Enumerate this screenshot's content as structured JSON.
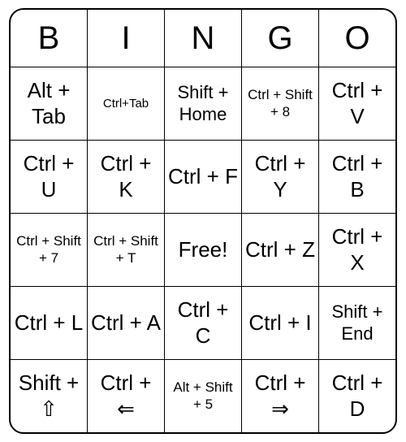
{
  "headers": [
    "B",
    "I",
    "N",
    "G",
    "O"
  ],
  "grid": [
    [
      {
        "text": "Alt + Tab",
        "size": "large"
      },
      {
        "text": "Ctrl+Tab",
        "size": "xsmall"
      },
      {
        "text": "Shift + Home",
        "size": "med"
      },
      {
        "text": "Ctrl + Shift + 8",
        "size": "small"
      },
      {
        "text": "Ctrl + V",
        "size": "large"
      }
    ],
    [
      {
        "text": "Ctrl + U",
        "size": "large"
      },
      {
        "text": "Ctrl + K",
        "size": "large"
      },
      {
        "text": "Ctrl + F",
        "size": "large"
      },
      {
        "text": "Ctrl + Y",
        "size": "large"
      },
      {
        "text": "Ctrl + B",
        "size": "large"
      }
    ],
    [
      {
        "text": "Ctrl + Shift + 7",
        "size": "small"
      },
      {
        "text": "Ctrl + Shift + T",
        "size": "small"
      },
      {
        "text": "Free!",
        "size": "large"
      },
      {
        "text": "Ctrl + Z",
        "size": "large"
      },
      {
        "text": "Ctrl + X",
        "size": "large"
      }
    ],
    [
      {
        "text": "Ctrl + L",
        "size": "large"
      },
      {
        "text": "Ctrl + A",
        "size": "large"
      },
      {
        "text": "Ctrl + C",
        "size": "large"
      },
      {
        "text": "Ctrl + I",
        "size": "large"
      },
      {
        "text": "Shift + End",
        "size": "med"
      }
    ],
    [
      {
        "text": "Shift + ⇧",
        "size": "large"
      },
      {
        "text": "Ctrl + ⇐",
        "size": "large"
      },
      {
        "text": "Alt + Shift + 5",
        "size": "small"
      },
      {
        "text": "Ctrl + ⇒",
        "size": "large"
      },
      {
        "text": "Ctrl + D",
        "size": "large"
      }
    ]
  ]
}
